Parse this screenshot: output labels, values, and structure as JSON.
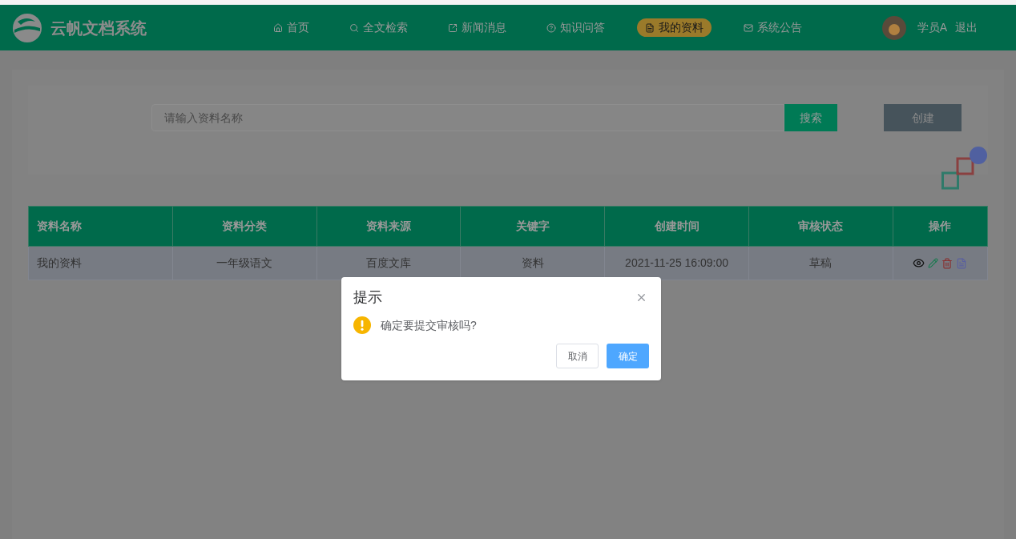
{
  "header": {
    "logo_text": "云帆文档系统",
    "nav": [
      {
        "label": "首页",
        "selected": false
      },
      {
        "label": "全文检索",
        "selected": false
      },
      {
        "label": "新闻消息",
        "selected": false
      },
      {
        "label": "知识问答",
        "selected": false
      },
      {
        "label": "我的资料",
        "selected": true
      },
      {
        "label": "系统公告",
        "selected": false
      }
    ],
    "user": "学员A",
    "logout": "退出"
  },
  "search": {
    "placeholder": "请输入资料名称",
    "button": "搜索",
    "create_button": "创建"
  },
  "table": {
    "columns": [
      "资料名称",
      "资料分类",
      "资料来源",
      "关键字",
      "创建时间",
      "审核状态",
      "操作"
    ],
    "rows": [
      {
        "cells": [
          "我的资料",
          "一年级语文",
          "百度文库",
          "资料",
          "2021-11-25 16:09:00",
          "草稿"
        ]
      }
    ]
  },
  "dialog": {
    "title": "提示",
    "message": "确定要提交审核吗?",
    "cancel": "取消",
    "confirm": "确定"
  }
}
